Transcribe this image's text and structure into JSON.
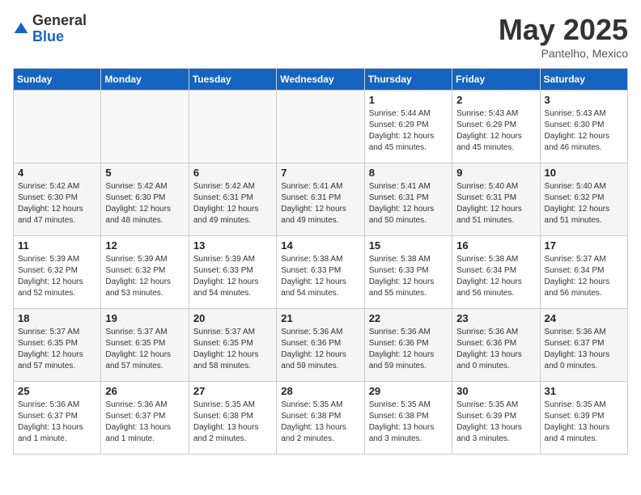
{
  "header": {
    "logo_general": "General",
    "logo_blue": "Blue",
    "month_title": "May 2025",
    "location": "Pantelho, Mexico"
  },
  "days_of_week": [
    "Sunday",
    "Monday",
    "Tuesday",
    "Wednesday",
    "Thursday",
    "Friday",
    "Saturday"
  ],
  "weeks": [
    [
      {
        "num": "",
        "info": ""
      },
      {
        "num": "",
        "info": ""
      },
      {
        "num": "",
        "info": ""
      },
      {
        "num": "",
        "info": ""
      },
      {
        "num": "1",
        "info": "Sunrise: 5:44 AM\nSunset: 6:29 PM\nDaylight: 12 hours\nand 45 minutes."
      },
      {
        "num": "2",
        "info": "Sunrise: 5:43 AM\nSunset: 6:29 PM\nDaylight: 12 hours\nand 45 minutes."
      },
      {
        "num": "3",
        "info": "Sunrise: 5:43 AM\nSunset: 6:30 PM\nDaylight: 12 hours\nand 46 minutes."
      }
    ],
    [
      {
        "num": "4",
        "info": "Sunrise: 5:42 AM\nSunset: 6:30 PM\nDaylight: 12 hours\nand 47 minutes."
      },
      {
        "num": "5",
        "info": "Sunrise: 5:42 AM\nSunset: 6:30 PM\nDaylight: 12 hours\nand 48 minutes."
      },
      {
        "num": "6",
        "info": "Sunrise: 5:42 AM\nSunset: 6:31 PM\nDaylight: 12 hours\nand 49 minutes."
      },
      {
        "num": "7",
        "info": "Sunrise: 5:41 AM\nSunset: 6:31 PM\nDaylight: 12 hours\nand 49 minutes."
      },
      {
        "num": "8",
        "info": "Sunrise: 5:41 AM\nSunset: 6:31 PM\nDaylight: 12 hours\nand 50 minutes."
      },
      {
        "num": "9",
        "info": "Sunrise: 5:40 AM\nSunset: 6:31 PM\nDaylight: 12 hours\nand 51 minutes."
      },
      {
        "num": "10",
        "info": "Sunrise: 5:40 AM\nSunset: 6:32 PM\nDaylight: 12 hours\nand 51 minutes."
      }
    ],
    [
      {
        "num": "11",
        "info": "Sunrise: 5:39 AM\nSunset: 6:32 PM\nDaylight: 12 hours\nand 52 minutes."
      },
      {
        "num": "12",
        "info": "Sunrise: 5:39 AM\nSunset: 6:32 PM\nDaylight: 12 hours\nand 53 minutes."
      },
      {
        "num": "13",
        "info": "Sunrise: 5:39 AM\nSunset: 6:33 PM\nDaylight: 12 hours\nand 54 minutes."
      },
      {
        "num": "14",
        "info": "Sunrise: 5:38 AM\nSunset: 6:33 PM\nDaylight: 12 hours\nand 54 minutes."
      },
      {
        "num": "15",
        "info": "Sunrise: 5:38 AM\nSunset: 6:33 PM\nDaylight: 12 hours\nand 55 minutes."
      },
      {
        "num": "16",
        "info": "Sunrise: 5:38 AM\nSunset: 6:34 PM\nDaylight: 12 hours\nand 56 minutes."
      },
      {
        "num": "17",
        "info": "Sunrise: 5:37 AM\nSunset: 6:34 PM\nDaylight: 12 hours\nand 56 minutes."
      }
    ],
    [
      {
        "num": "18",
        "info": "Sunrise: 5:37 AM\nSunset: 6:35 PM\nDaylight: 12 hours\nand 57 minutes."
      },
      {
        "num": "19",
        "info": "Sunrise: 5:37 AM\nSunset: 6:35 PM\nDaylight: 12 hours\nand 57 minutes."
      },
      {
        "num": "20",
        "info": "Sunrise: 5:37 AM\nSunset: 6:35 PM\nDaylight: 12 hours\nand 58 minutes."
      },
      {
        "num": "21",
        "info": "Sunrise: 5:36 AM\nSunset: 6:36 PM\nDaylight: 12 hours\nand 59 minutes."
      },
      {
        "num": "22",
        "info": "Sunrise: 5:36 AM\nSunset: 6:36 PM\nDaylight: 12 hours\nand 59 minutes."
      },
      {
        "num": "23",
        "info": "Sunrise: 5:36 AM\nSunset: 6:36 PM\nDaylight: 13 hours\nand 0 minutes."
      },
      {
        "num": "24",
        "info": "Sunrise: 5:36 AM\nSunset: 6:37 PM\nDaylight: 13 hours\nand 0 minutes."
      }
    ],
    [
      {
        "num": "25",
        "info": "Sunrise: 5:36 AM\nSunset: 6:37 PM\nDaylight: 13 hours\nand 1 minute."
      },
      {
        "num": "26",
        "info": "Sunrise: 5:36 AM\nSunset: 6:37 PM\nDaylight: 13 hours\nand 1 minute."
      },
      {
        "num": "27",
        "info": "Sunrise: 5:35 AM\nSunset: 6:38 PM\nDaylight: 13 hours\nand 2 minutes."
      },
      {
        "num": "28",
        "info": "Sunrise: 5:35 AM\nSunset: 6:38 PM\nDaylight: 13 hours\nand 2 minutes."
      },
      {
        "num": "29",
        "info": "Sunrise: 5:35 AM\nSunset: 6:38 PM\nDaylight: 13 hours\nand 3 minutes."
      },
      {
        "num": "30",
        "info": "Sunrise: 5:35 AM\nSunset: 6:39 PM\nDaylight: 13 hours\nand 3 minutes."
      },
      {
        "num": "31",
        "info": "Sunrise: 5:35 AM\nSunset: 6:39 PM\nDaylight: 13 hours\nand 4 minutes."
      }
    ]
  ]
}
